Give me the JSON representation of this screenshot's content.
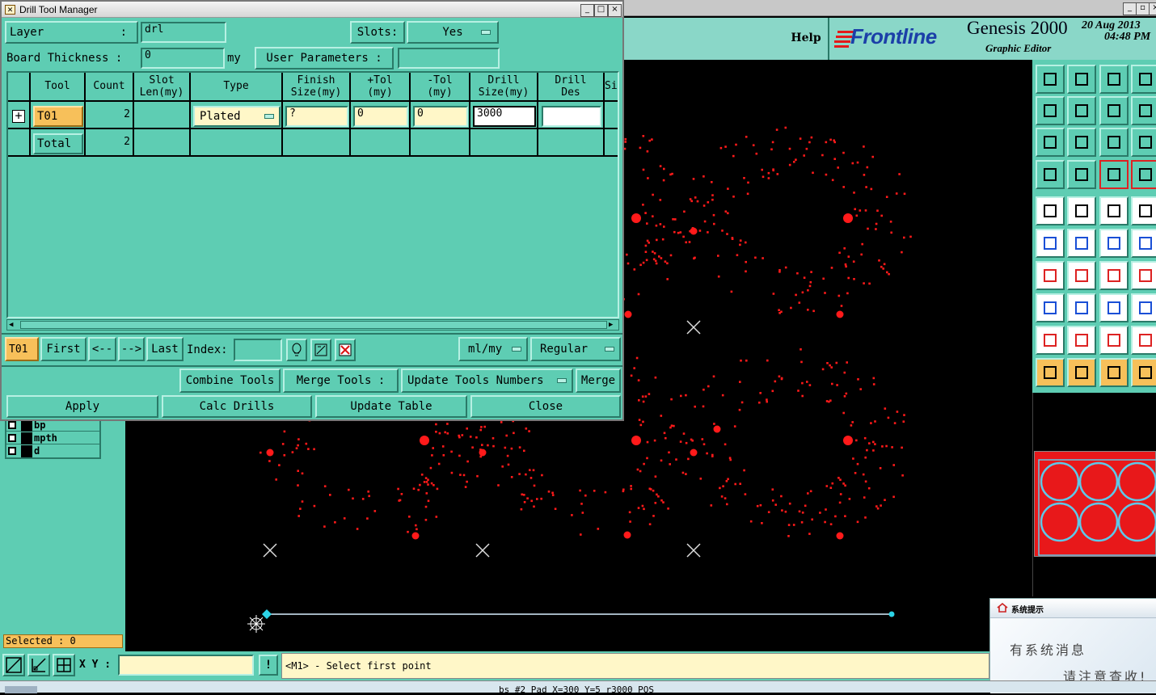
{
  "dialog": {
    "title": "Drill Tool Manager",
    "layer_label": "Layer",
    "layer_colon": ":",
    "layer_value": "drl",
    "slots_label": "Slots:",
    "slots_value": "Yes",
    "board_thickness_label": "Board Thickness :",
    "board_thickness_value": "0",
    "board_thickness_unit": "my",
    "user_params_label": "User Parameters :",
    "user_params_value": "",
    "columns": [
      "Tool",
      "Count",
      "Slot\nLen(my)",
      "Type",
      "Finish\nSize(my)",
      "+Tol\n(my)",
      "-Tol\n(my)",
      "Drill\nSize(my)",
      "Drill\nDes",
      "Si"
    ],
    "rows": [
      {
        "tool": "T01",
        "count": "2",
        "type": "Plated",
        "finish": "?",
        "ptol": "0",
        "mtol": "0",
        "drill_size": "3000",
        "drill_des": ""
      },
      {
        "tool": "Total",
        "count": "2"
      }
    ],
    "nav": {
      "current": "T01",
      "first": "First",
      "prev": "<--",
      "next": "-->",
      "last": "Last",
      "index_label": "Index:",
      "index_value": "",
      "units": "ml/my",
      "mode": "Regular"
    },
    "buttons": {
      "combine": "Combine Tools",
      "merge_tools": "Merge Tools :",
      "update_numbers": "Update Tools Numbers",
      "merge": "Merge",
      "apply": "Apply",
      "calc": "Calc Drills",
      "update_table": "Update Table",
      "close": "Close"
    }
  },
  "app": {
    "help": "Help",
    "brand": "Frontline",
    "product": "Genesis 2000",
    "subtitle": "Graphic Editor",
    "date": "20 Aug 2013",
    "time": "04:48 PM"
  },
  "layers": [
    "bp",
    "mpth",
    "d"
  ],
  "selected_label": "Selected : 0",
  "xy_label": "X Y :",
  "xy_value": "",
  "prompt": "<M1> - Select first point",
  "status": "bs #2 Pad X=300 Y=5 r3000 POS",
  "popup": {
    "title": "系统提示",
    "line1": "有系统消息",
    "line2": "请注意查收!"
  },
  "colors": {
    "teal": "#5ecdb3",
    "pad_red": "#ff1a1a",
    "yellow_bar": "#fff7c8"
  }
}
